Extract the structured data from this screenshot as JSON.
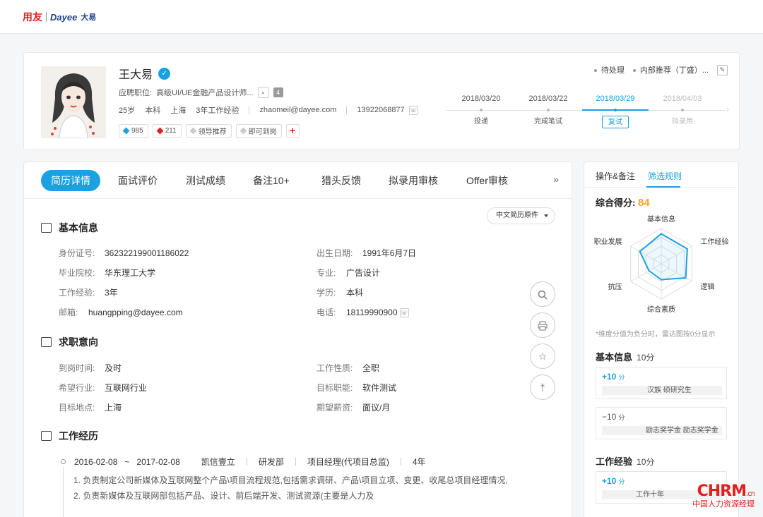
{
  "brand": {
    "cn": "用友",
    "cn_sub": "yonyou",
    "dayee": "Dayee",
    "dayee_cn": "大易"
  },
  "candidate": {
    "name": "王大易",
    "position_label": "应聘职位:",
    "position": "高级UI/UE金融产品设计师...",
    "position_count": "4",
    "age": "25岁",
    "education": "本科",
    "city": "上海",
    "experience": "3年工作经验",
    "email": "zhaomeil@dayee.com",
    "phone": "13922068877",
    "tags": [
      "985",
      "211",
      "领导推荐",
      "即可到岗"
    ],
    "add_tag": "+"
  },
  "status": {
    "state": "待处理",
    "source": "内部推荐（丁盛）..."
  },
  "timeline": [
    {
      "date": "2018/03/20",
      "label": "投递",
      "state": "done"
    },
    {
      "date": "2018/03/22",
      "label": "完成笔试",
      "state": "done"
    },
    {
      "date": "2018/03/29",
      "label": "复试",
      "state": "active"
    },
    {
      "date": "2018/04/03",
      "label": "拟录用",
      "state": "future"
    }
  ],
  "tabs": [
    "简历详情",
    "面试评价",
    "测试成绩",
    "备注10+",
    "猎头反馈",
    "拟录用审核",
    "Offer审核"
  ],
  "tab_more": "»",
  "lang_select": "中文简历原件",
  "basic_info": {
    "title": "基本信息",
    "id_label": "身份证号:",
    "id": "362322199001186022",
    "birth_label": "出生日期:",
    "birth": "1991年6月7日",
    "school_label": "毕业院校:",
    "school": "华东理工大学",
    "major_label": "专业:",
    "major": "广告设计",
    "exp_label": "工作经验:",
    "exp": "3年",
    "degree_label": "学历:",
    "degree": "本科",
    "email_label": "邮箱:",
    "email": "huangpping@dayee.com",
    "phone_label": "电话:",
    "phone": "18119990900"
  },
  "intent": {
    "title": "求职意向",
    "arrive_label": "到岗时间:",
    "arrive": "及时",
    "nature_label": "工作性质:",
    "nature": "全职",
    "industry_label": "希望行业:",
    "industry": "互联网行业",
    "function_label": "目标职能:",
    "function": "软件测试",
    "location_label": "目标地点:",
    "location": "上海",
    "salary_label": "期望薪资:",
    "salary": "面议/月"
  },
  "work": {
    "title": "工作经历",
    "start": "2016-02-08",
    "tilde": "~",
    "end": "2017-02-08",
    "company": "凯信壹立",
    "dept": "研发部",
    "role": "项目经理(代项目总监)",
    "years": "4年",
    "desc1": "1. 负责制定公司新媒体及互联网整个产品\\项目流程规范,包括需求调研、产品\\项目立项、变更、收尾总项目经理情况,",
    "desc2": "2. 负责新媒体及互联网部包括产品、设计、前后端开发、测试资源(主要是人力及"
  },
  "side": {
    "tab1": "操作&备注",
    "tab2": "筛选规则",
    "score_label": "综合得分:",
    "score": "84",
    "radar_labels": [
      "基本信息",
      "工作经验",
      "逻辑",
      "综合素质",
      "抗压",
      "职业发展"
    ],
    "radar_values": [
      0.85,
      0.85,
      0.8,
      0.45,
      0.4,
      0.7
    ],
    "note": "*维度分值为负分时，雷达图按0分显示",
    "basic_title": "基本信息",
    "basic_pts": "10分",
    "rule1_amt": "+10",
    "rule1_unit": "分",
    "rule1_text": "汉族 硕研究生",
    "rule2_amt": "−10",
    "rule2_unit": "分",
    "rule2_text": "励志奖学金  励志奖学金",
    "exp_title": "工作经验",
    "exp_pts": "10分",
    "rule3_amt": "+10",
    "rule3_unit": "分",
    "rule3_text": "工作十年"
  },
  "watermark": {
    "big": "CHRM",
    "dot": ".cn",
    "small": "中国人力资源经理"
  },
  "colors": {
    "accent": "#1ba0e1",
    "score": "#f5a623",
    "brand_red": "#e02020"
  }
}
